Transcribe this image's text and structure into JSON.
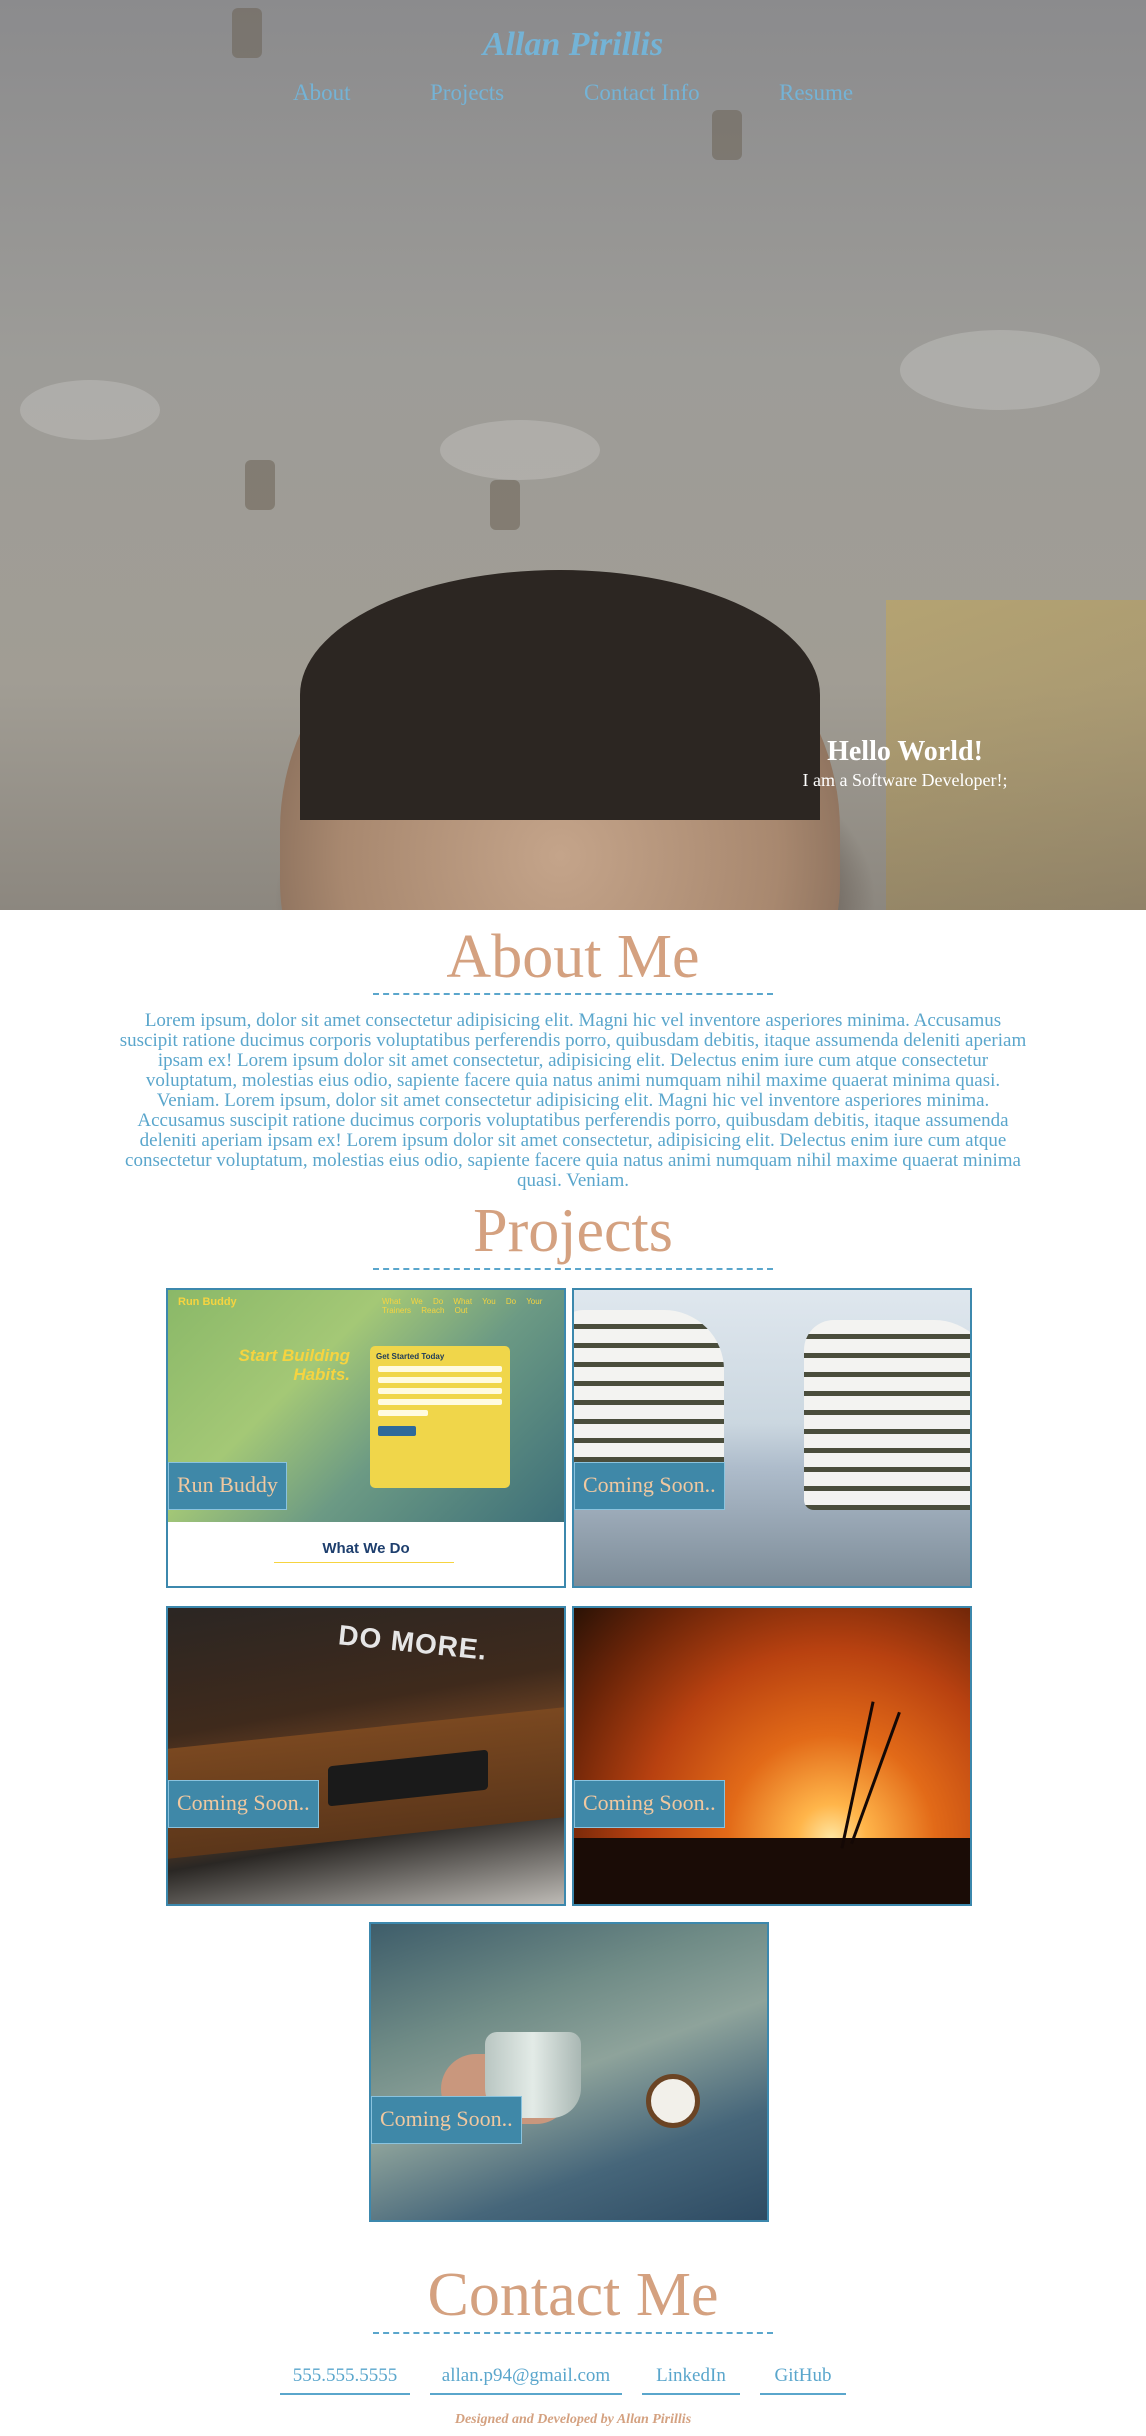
{
  "header": {
    "brand": "Allan Pirillis",
    "nav": [
      "About",
      "Projects",
      "Contact Info",
      "Resume"
    ]
  },
  "hero": {
    "greeting": "Hello World!",
    "tagline": "I am a Software Developer!;"
  },
  "about": {
    "title": "About Me",
    "body": "Lorem ipsum, dolor sit amet consectetur adipisicing elit. Magni hic vel inventore asperiores minima. Accusamus suscipit ratione ducimus corporis voluptatibus perferendis porro, quibusdam debitis, itaque assumenda deleniti aperiam ipsam ex! Lorem ipsum dolor sit amet consectetur, adipisicing elit. Delectus enim iure cum atque consectetur voluptatum, molestias eius odio, sapiente facere quia natus animi numquam nihil maxime quaerat minima quasi. Veniam. Lorem ipsum, dolor sit amet consectetur adipisicing elit. Magni hic vel inventore asperiores minima. Accusamus suscipit ratione ducimus corporis voluptatibus perferendis porro, quibusdam debitis, itaque assumenda deleniti aperiam ipsam ex! Lorem ipsum dolor sit amet consectetur, adipisicing elit. Delectus enim iure cum atque consectetur voluptatum, molestias eius odio, sapiente facere quia natus animi numquam nihil maxime quaerat minima quasi. Veniam."
  },
  "projects": {
    "title": "Projects",
    "cards": [
      {
        "label": "Run Buddy"
      },
      {
        "label": "Coming Soon.."
      },
      {
        "label": "Coming Soon.."
      },
      {
        "label": "Coming Soon.."
      },
      {
        "label": "Coming Soon.."
      }
    ],
    "run_buddy_preview": {
      "logo": "Run Buddy",
      "nav": "What We Do  What You Do  Your Trainers  Reach Out",
      "headline": "Start Building Habits.",
      "form_title": "Get Started Today",
      "section_title": "What We Do"
    },
    "coming_soon_art": {
      "desk_text": "DO MORE."
    }
  },
  "contact": {
    "title": "Contact Me",
    "links": [
      "555.555.5555",
      "allan.p94@gmail.com",
      "LinkedIn",
      "GitHub"
    ]
  },
  "footer": {
    "credit": "Designed and Developed by Allan Pirillis"
  },
  "colors": {
    "accent_blue": "#5aa6cc",
    "heading_peach": "#d4a180",
    "card_border": "#3c88ad",
    "label_bg": "#3f88a8"
  }
}
